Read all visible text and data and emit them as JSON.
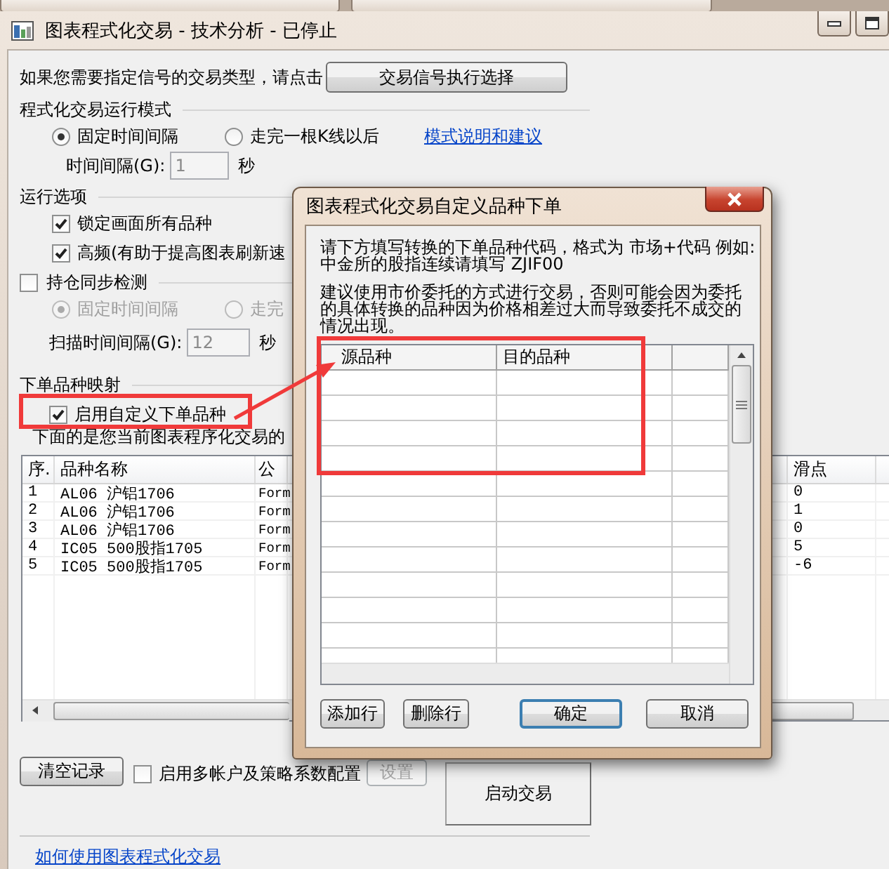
{
  "window": {
    "title": "图表程式化交易 - 技术分析 - 已停止"
  },
  "signal": {
    "prompt": "如果您需要指定信号的交易类型，请点击",
    "button": "交易信号执行选择"
  },
  "run_mode": {
    "heading": "程式化交易运行模式",
    "options": [
      {
        "label": "固定时间间隔",
        "selected": true
      },
      {
        "label": "走完一根K线以后",
        "selected": false
      }
    ],
    "link": "模式说明和建议",
    "interval": {
      "label": "时间间隔(G):",
      "value": "1",
      "unit": "秒",
      "disabled": true
    }
  },
  "run_options": {
    "heading": "运行选项",
    "items": [
      {
        "label": "锁定画面所有品种",
        "checked": true
      },
      {
        "label": "高频(有助于提高图表刷新速",
        "checked": true
      }
    ]
  },
  "position_sync": {
    "label": "持仓同步检测",
    "checked": false,
    "options": [
      {
        "label": "固定时间间隔",
        "selected": true,
        "disabled": true
      },
      {
        "label": "走完",
        "selected": false,
        "disabled": true
      }
    ],
    "interval": {
      "label": "扫描时间间隔(G):",
      "value": "12",
      "unit": "秒",
      "disabled": true
    }
  },
  "order_mapping": {
    "heading": "下单品种映射",
    "checkbox": {
      "label": "启用自定义下单品种",
      "checked": true
    },
    "note": "下面的是您当前图表程序化交易的"
  },
  "table": {
    "columns": [
      "序.",
      "品种名称",
      "公",
      "滑点"
    ],
    "rows": [
      {
        "cells": [
          "1",
          "AL06 沪铝1706",
          "Form",
          "0"
        ]
      },
      {
        "cells": [
          "2",
          "AL06 沪铝1706",
          "Form",
          "1"
        ]
      },
      {
        "cells": [
          "3",
          "AL06 沪铝1706",
          "Form",
          "0"
        ]
      },
      {
        "cells": [
          "4",
          "IC05 500股指1705",
          "Form",
          "5"
        ]
      },
      {
        "cells": [
          "5",
          "IC05 500股指1705",
          "Form",
          "-6"
        ]
      }
    ]
  },
  "bottom": {
    "clear_button": "清空记录",
    "multi_account": {
      "label": "启用多帐户及策略系数配置",
      "checked": false
    },
    "settings_button": {
      "label": "设置",
      "disabled": true
    },
    "start_button": "启动交易",
    "help_link": "如何使用图表程式化交易"
  },
  "dialog": {
    "title": "图表程式化交易自定义品种下单",
    "paragraphs": [
      [
        "请下方填写转换的下单品种代码，格式为 市场+代码 例如:",
        "中金所的股指连续请填写 ZJIF00"
      ],
      [
        "建议使用市价委托的方式进行交易，否则可能会因为委托",
        "的具体转换的品种因为价格相差过大而导致委托不成交的",
        "情况出现。"
      ]
    ],
    "grid": {
      "columns": [
        "源品种",
        "目的品种"
      ]
    },
    "buttons": [
      {
        "label": "添加行",
        "default": false
      },
      {
        "label": "删除行",
        "default": false
      },
      {
        "label": "确定",
        "default": true
      },
      {
        "label": "取消",
        "default": false
      }
    ]
  },
  "annotations": [
    {
      "kind": "highlight"
    },
    {
      "kind": "highlight"
    },
    {
      "kind": "arrow"
    }
  ]
}
